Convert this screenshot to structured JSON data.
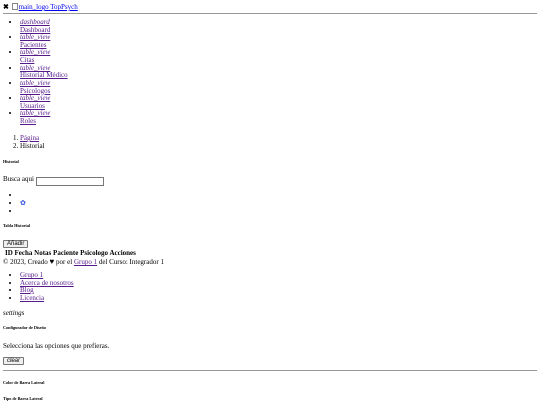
{
  "topbar": {
    "close_glyph": "✖",
    "logo_alt": "main_logo",
    "brand": "TopPsych"
  },
  "sidebar": {
    "items": [
      {
        "icon": "dashboard",
        "label": "Dashboard"
      },
      {
        "icon": "table_view",
        "label": "Pacientes"
      },
      {
        "icon": "table_view",
        "label": "Citas"
      },
      {
        "icon": "table_view",
        "label": "Historial Médico"
      },
      {
        "icon": "table_view",
        "label": "Psicologos"
      },
      {
        "icon": "table_view",
        "label": "Usuarios"
      },
      {
        "icon": "table_view",
        "label": "Roles"
      }
    ]
  },
  "breadcrumb": {
    "items": [
      "Página",
      "Historial"
    ]
  },
  "header": {
    "title": "Historial",
    "search_label": "Busca aqui",
    "search_value": "",
    "search_placeholder": ""
  },
  "toolbar": {
    "settings_icon": "gear-icon",
    "gear_color": "#2f4fd6"
  },
  "table": {
    "title": "Tabla Historial",
    "add_label": "Añadir",
    "columns": [
      "ID",
      "Fecha",
      "Notas",
      "Paciente",
      "Psicologo",
      "Acciones"
    ]
  },
  "footer": {
    "copy": "© 2023, Creado",
    "by": "por el",
    "group_link": "Grupo 1",
    "course": "del Curso: Integrador 1",
    "links": [
      "Grupo 1",
      "Acerca de nosotros",
      "Blog",
      "Licencia"
    ]
  },
  "configurator": {
    "toggle_label": "settings",
    "title": "Configurador de Diseño",
    "subtitle": "Selecciona las opciones que prefieras.",
    "clear_label": "clear",
    "sidebar_color_title": "Color de Barra Lateral",
    "sidebar_type_title": "Tipo de Barra Lateral"
  }
}
